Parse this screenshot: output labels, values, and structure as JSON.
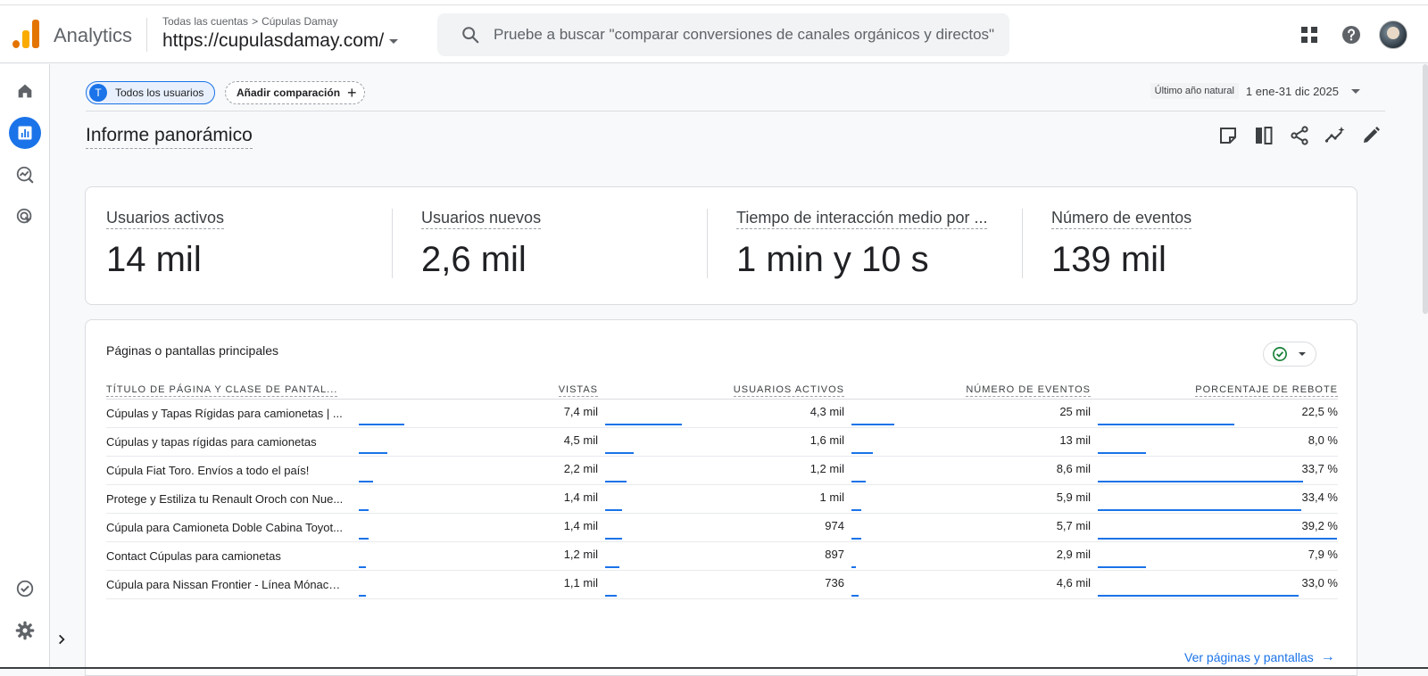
{
  "header": {
    "app_name": "Analytics",
    "breadcrumb": {
      "accounts": "Todas las cuentas",
      "separator": ">",
      "account": "Cúpulas Damay"
    },
    "property": "https://cupulasdamay.com/",
    "search_placeholder": "Pruebe a buscar \"comparar conversiones de canales orgánicos y directos\"",
    "icons": [
      "apps-grid-icon",
      "help-icon",
      "avatar"
    ]
  },
  "rail": {
    "items": [
      "home-icon",
      "reports-icon",
      "explore-icon",
      "advertising-icon"
    ],
    "active": "reports-icon",
    "bottom": [
      "admin-check-icon",
      "settings-icon"
    ],
    "expand": "chevron-right-icon"
  },
  "toolbar": {
    "segment_initial": "T",
    "segment_label": "Todos los usuarios",
    "compare_label": "Añadir comparación",
    "compare_plus": "+",
    "date_label": "Último año natural",
    "date_value": "1 ene-31 dic 2025"
  },
  "page_title": "Informe panorámico",
  "kpis": [
    {
      "label": "Usuarios activos",
      "value": "14 mil"
    },
    {
      "label": "Usuarios nuevos",
      "value": "2,6 mil"
    },
    {
      "label": "Tiempo de interacción medio por ...",
      "value": "1 min y 10 s"
    },
    {
      "label": "Número de eventos",
      "value": "139 mil"
    }
  ],
  "table": {
    "title": "Páginas o pantallas principales",
    "headers": [
      "TÍTULO DE PÁGINA Y CLASE DE PANTAL...",
      "VISTAS",
      "USUARIOS ACTIVOS",
      "NÚMERO DE EVENTOS",
      "PORCENTAJE DE REBOTE"
    ],
    "rows": [
      {
        "name": "Cúpulas y Tapas Rígidas para camionetas | ...",
        "views": "7,4 mil",
        "users": "4,3 mil",
        "events": "25 mil",
        "bounce": "22,5 %",
        "bars": [
          0.19,
          0.32,
          0.18,
          0.57
        ]
      },
      {
        "name": "Cúpulas y tapas rígidas para camionetas",
        "views": "4,5 mil",
        "users": "1,6 mil",
        "events": "13 mil",
        "bounce": "8,0 %",
        "bars": [
          0.12,
          0.12,
          0.09,
          0.2
        ]
      },
      {
        "name": "Cúpula Fiat Toro. Envíos a todo el país!",
        "views": "2,2 mil",
        "users": "1,2 mil",
        "events": "8,6 mil",
        "bounce": "33,7 %",
        "bars": [
          0.06,
          0.09,
          0.06,
          0.86
        ]
      },
      {
        "name": "Protege y Estiliza tu Renault Oroch con Nue...",
        "views": "1,4 mil",
        "users": "1 mil",
        "events": "5,9 mil",
        "bounce": "33,4 %",
        "bars": [
          0.04,
          0.07,
          0.04,
          0.85
        ]
      },
      {
        "name": "Cúpula para Camioneta Doble Cabina Toyot...",
        "views": "1,4 mil",
        "users": "974",
        "events": "5,7 mil",
        "bounce": "39,2 %",
        "bars": [
          0.04,
          0.07,
          0.04,
          1.0
        ]
      },
      {
        "name": "Contact Cúpulas para camionetas",
        "views": "1,2 mil",
        "users": "897",
        "events": "2,9 mil",
        "bounce": "7,9 %",
        "bars": [
          0.03,
          0.06,
          0.02,
          0.2
        ]
      },
      {
        "name": "Cúpula para Nissan Frontier - Línea Mónaco ...",
        "views": "1,1 mil",
        "users": "736",
        "events": "4,6 mil",
        "bounce": "33,0 %",
        "bars": [
          0.03,
          0.05,
          0.03,
          0.84
        ]
      }
    ],
    "link": "Ver páginas y pantallas",
    "link_arrow": "→"
  },
  "colors": {
    "accent": "#1a73e8",
    "logo_orange": "#f9ab00",
    "logo_dark": "#e37400"
  }
}
